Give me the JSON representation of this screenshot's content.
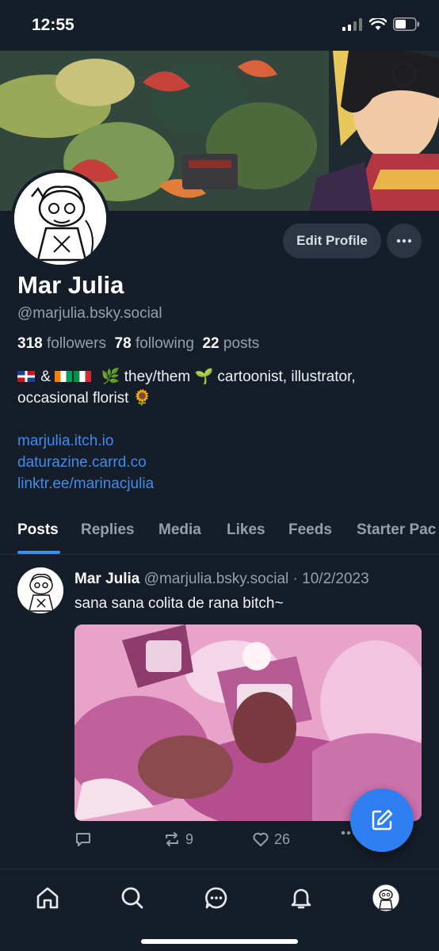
{
  "status_bar": {
    "time": "12:55"
  },
  "profile": {
    "display_name": "Mar Julia",
    "handle": "@marjulia.bsky.social",
    "followers_count": "318",
    "followers_label": "followers",
    "following_count": "78",
    "following_label": "following",
    "posts_count": "22",
    "posts_label": "posts",
    "bio_line1_amp": "&",
    "bio_line1_rest": "they/them 🌱 cartoonist, illustrator,",
    "bio_line2": "occasional florist 🌻",
    "links": [
      "marjulia.itch.io",
      "daturazine.carrd.co",
      "linktr.ee/marinacjulia"
    ],
    "edit_profile_label": "Edit Profile"
  },
  "tabs": [
    "Posts",
    "Replies",
    "Media",
    "Likes",
    "Feeds",
    "Starter Pac"
  ],
  "post": {
    "author_name": "Mar Julia",
    "author_handle": "@marjulia.bsky.social",
    "separator": "·",
    "date": "10/2/2023",
    "text": "sana sana colita de rana bitch~",
    "reposts": "9",
    "likes": "26"
  },
  "icons": {
    "more": "ellipsis-icon",
    "compose": "compose-pencil-icon",
    "nav": [
      "home-icon",
      "search-icon",
      "chat-icon",
      "bell-icon",
      "profile-avatar"
    ]
  },
  "colors": {
    "background": "#151d28",
    "accent": "#3f8cf0",
    "fab": "#2f7ff3",
    "muted": "#93a0ad"
  }
}
